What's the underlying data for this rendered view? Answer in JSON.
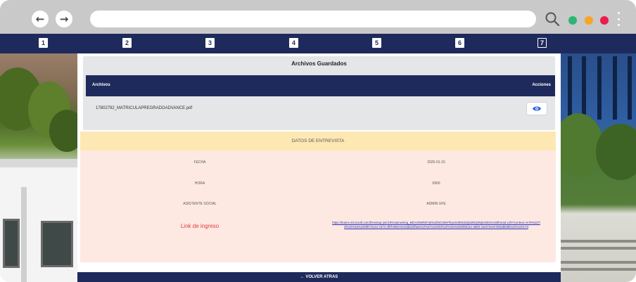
{
  "browser": {
    "back_icon": "←",
    "forward_icon": "→",
    "url": "",
    "dot_colors": [
      "#2bb673",
      "#f6a623",
      "#ec1c4c"
    ]
  },
  "steps": [
    {
      "label": "1"
    },
    {
      "label": "2"
    },
    {
      "label": "3"
    },
    {
      "label": "4"
    },
    {
      "label": "5"
    },
    {
      "label": "6"
    },
    {
      "label": "7"
    }
  ],
  "files": {
    "title": "Archivos Guardados",
    "col_files": "Archivos",
    "col_actions": "Acciones",
    "rows": [
      {
        "name": "17802792_MATRICULAPREGRADOADVANCE.pdf"
      }
    ]
  },
  "interview": {
    "title": "DATOS DE ENTREVISTA",
    "fecha_label": "FECHA",
    "fecha_value": "2025-01-15",
    "hora_label": "HORA",
    "hora_value": "0900",
    "asistente_label": "ASISTENTE SOCIAL",
    "asistente_value": "ADMIN UFE",
    "link_label": "Link de ingreso",
    "link_value": "https://teams.microsoft.com/l/meetup-join/19%3ameeting_MDA3NWNhYjItNzZiNC00MTkyLWJlMGItZjI3ZDQ0NjI2NDI1%40thread.v2/0?context=%7b%22Tid%22%3a%2205fe7ac12-c674-4f9f-8833-8e33dd31ffaa%22%2c%22Oid%22%3a%228ef8d11e-a583-41e0-bce9-803abbd5b1cb%22%7d"
  },
  "footer": {
    "back_label": "← VOLVER ATRAS"
  },
  "colors": {
    "navy": "#1f2a5c",
    "warning_header": "#fde8b4",
    "interview_bg": "#fde9e2",
    "link": "#2430b8",
    "red_label": "#e03b3b"
  }
}
